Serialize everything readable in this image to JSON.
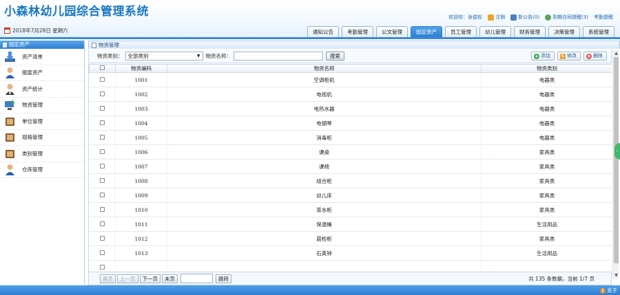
{
  "app": {
    "title": "小森林幼儿园综合管理系统"
  },
  "top_links": {
    "welcome": "欢迎你：张俊松",
    "logout": "注销",
    "notice": "新公告(0)",
    "contract": "到期合同提醒(3)",
    "attendance": "考勤提醒"
  },
  "date_text": "2018年7月28日 星期六",
  "nav_tabs": [
    "通知公告",
    "考勤管理",
    "公文管理",
    "固定资产",
    "员工管理",
    "幼儿管理",
    "财务管理",
    "决策管理",
    "系统管理"
  ],
  "sidebar": {
    "title": "固定资产",
    "items": [
      "资产清单",
      "报废资产",
      "资产统计",
      "物资管理",
      "单位管理",
      "规格管理",
      "类别管理",
      "仓库管理"
    ]
  },
  "panel": {
    "title": "物资管理"
  },
  "toolbar": {
    "category_label": "物资类别：",
    "category_value": "全部类别",
    "name_label": "物资名称：",
    "search": "搜索",
    "add": "添加",
    "edit": "修改",
    "delete": "删除"
  },
  "table": {
    "headers": [
      "物资编码",
      "物资名称",
      "物资类别"
    ],
    "rows": [
      [
        "1001",
        "空调柜机",
        "电器类"
      ],
      [
        "1002",
        "电视机",
        "电器类"
      ],
      [
        "1003",
        "电热水器",
        "电器类"
      ],
      [
        "1004",
        "电钢琴",
        "电器类"
      ],
      [
        "1005",
        "消毒柜",
        "电器类"
      ],
      [
        "1006",
        "课桌",
        "家具类"
      ],
      [
        "1007",
        "课椅",
        "家具类"
      ],
      [
        "1008",
        "组合柜",
        "家具类"
      ],
      [
        "1009",
        "幼儿床",
        "家具类"
      ],
      [
        "1010",
        "茶水柜",
        "家具类"
      ],
      [
        "1011",
        "保温桶",
        "生活用品"
      ],
      [
        "1012",
        "晨检柜",
        "家具类"
      ],
      [
        "1013",
        "石英钟",
        "生活用品"
      ]
    ]
  },
  "pager": {
    "first": "首页",
    "prev": "上一页",
    "next": "下一页",
    "last": "末页",
    "jump": "跳转",
    "info": "共 135 条数据，当前 1/7 页"
  },
  "footer": {
    "about": "关于"
  },
  "colors": {
    "brand": "#1a78c2",
    "accent": "#2f7fd1",
    "active_tab": "#3c8ad8"
  }
}
